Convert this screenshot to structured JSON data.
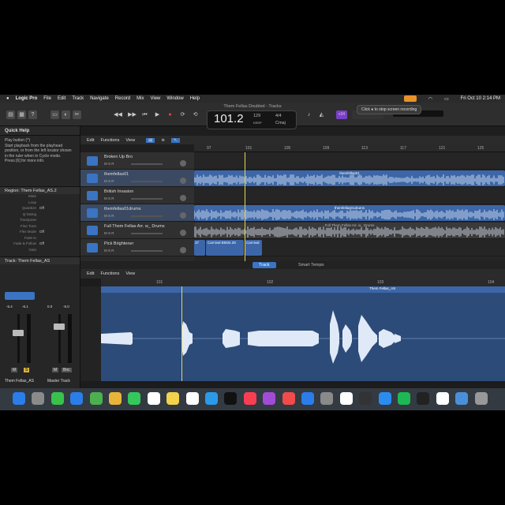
{
  "menubar": {
    "apple": "",
    "app": "Logic Pro",
    "items": [
      "File",
      "Edit",
      "Track",
      "Navigate",
      "Record",
      "Mix",
      "View",
      "Window",
      "Help"
    ],
    "datetime": "Fri Oct 10  2:14 PM"
  },
  "tooltip": "Click ● to stop screen recording",
  "window_title": "Them Fellas Doubled - Tracks",
  "lcd": {
    "tempo_main": "101.2",
    "tempo": "129",
    "keep": "KEEP",
    "sig": "4/4",
    "key": "Cmaj"
  },
  "badge": "v34",
  "quick_help": {
    "title": "Quick Help",
    "text": "Play button  (^)\nStart playback from the playhead position, or from the left locator shown in the ruler when in Cycle mode.\nPress [6] for more info."
  },
  "region_inspector": {
    "title": "Region:  Them Fellas_AS.2",
    "params": [
      {
        "k": "Mute",
        "v": ""
      },
      {
        "k": "Loop",
        "v": ""
      },
      {
        "k": "Quantize",
        "v": "Off"
      },
      {
        "k": "Q-Swing",
        "v": ""
      },
      {
        "k": "Transpose",
        "v": ""
      },
      {
        "k": "Fine Tune",
        "v": ""
      },
      {
        "k": "Flex Mode",
        "v": "Off"
      },
      {
        "k": "Fade In",
        "v": ""
      },
      {
        "k": "Fade & Follow",
        "v": "Off"
      },
      {
        "k": "Gain",
        "v": ""
      }
    ]
  },
  "track_inspector": {
    "title": "Track:  Them Fellas_AS"
  },
  "mixer": {
    "left": {
      "name": "Them Fellas_AS",
      "v1": "-5.4",
      "v2": "-6.1",
      "m": "M",
      "s": "S"
    },
    "right": {
      "name": "Master Track",
      "v1": "0.0",
      "v2": "-6.0",
      "m": "M",
      "bnc": "Bnc"
    }
  },
  "tracks_toolbar": {
    "edit": "Edit",
    "functions": "Functions",
    "view": "View"
  },
  "ruler": [
    "97",
    "101",
    "105",
    "109",
    "113",
    "117",
    "121",
    "125"
  ],
  "tracks": [
    {
      "name": "Broken Up Bro",
      "sel": false
    },
    {
      "name": "themfellas01",
      "sel": true
    },
    {
      "name": "British Invasion",
      "sel": false
    },
    {
      "name": "themfellas01drums",
      "sel": true
    },
    {
      "name": "Full Them Fellas Arr. w_ Drums",
      "sel": false
    },
    {
      "name": "Pick Brightener",
      "sel": false
    }
  ],
  "regions": {
    "r1": "themfellas01",
    "r3": "themfellas01drums",
    "r4": "Full Them Fellas Arr. w_ Drums",
    "r5a": "37",
    "r5b": "Carnival BM34.28",
    "r5c": "Carnival"
  },
  "tabs": {
    "track": "Track",
    "smart_tempo": "Smart Tempo"
  },
  "editor": {
    "edit": "Edit",
    "functions": "Functions",
    "view": "View",
    "ruler": [
      "101",
      "102",
      "103",
      "104"
    ],
    "region_name": "Them Fellas_AS"
  },
  "dock": [
    "Finder",
    "Launchpad",
    "Messages",
    "Mail",
    "Maps",
    "Photos",
    "FaceTime",
    "Calendar",
    "Notes",
    "Reminders",
    "Safari",
    "TV",
    "Music",
    "Podcasts",
    "News",
    "App Store",
    "Settings",
    "Chrome",
    "Logic",
    "Zoom",
    "Spotify",
    "Terminal",
    "Chrome",
    "Downloads",
    "Trash"
  ],
  "colors": {
    "accent": "#3a74c2",
    "region": "#3c66a8",
    "record": "#e5483b",
    "playhead": "#e5d85a"
  }
}
